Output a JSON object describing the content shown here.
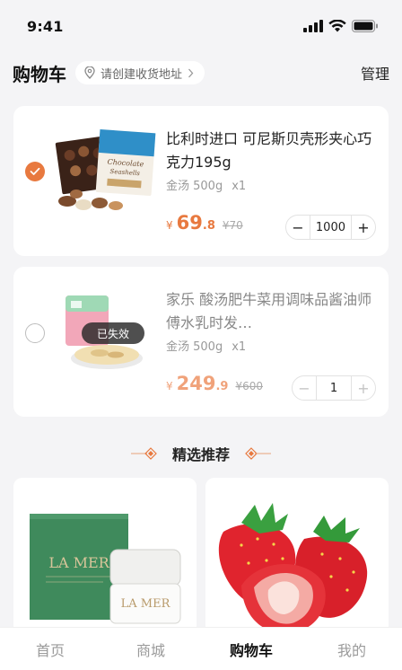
{
  "status_bar": {
    "time": "9:41"
  },
  "header": {
    "title": "购物车",
    "address_placeholder": "请创建收货地址",
    "manage_label": "管理"
  },
  "cart": {
    "items": [
      {
        "title": "比利时进口 可尼斯贝壳形夹心巧克力195g",
        "spec": "金汤 500g",
        "qty_label": "x1",
        "currency": "¥",
        "price_int": "69",
        "price_dec": ".8",
        "price_orig": "¥70",
        "quantity": "1000",
        "selected": true
      },
      {
        "title": "家乐 酸汤肥牛菜用调味品酱油师傅水乳时发…",
        "spec": "金汤 500g",
        "qty_label": "x1",
        "currency": "¥",
        "price_int": "249",
        "price_dec": ".9",
        "price_orig": "¥600",
        "quantity": "1",
        "selected": false,
        "badge": "已失效"
      }
    ],
    "stepper_minus": "−",
    "stepper_plus": "+"
  },
  "recommend": {
    "title": "精选推荐",
    "products": [
      {
        "name": "la-mer-cream",
        "box_brand": "LA MER",
        "jar_brand": "LA MER"
      },
      {
        "name": "strawberries"
      }
    ]
  },
  "tabbar": {
    "tabs": [
      {
        "label": "首页"
      },
      {
        "label": "商城"
      },
      {
        "label": "购物车"
      },
      {
        "label": "我的"
      }
    ],
    "active_index": 2
  },
  "colors": {
    "accent": "#e8793f",
    "background": "#f4f4f6",
    "card": "#ffffff"
  }
}
